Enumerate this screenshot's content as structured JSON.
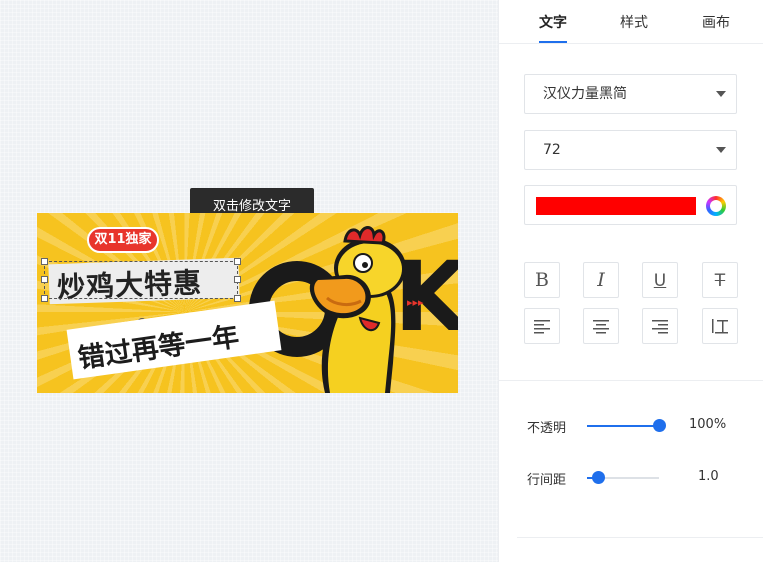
{
  "tooltip": {
    "text": "双击修改文字"
  },
  "banner": {
    "badge": "双11独家",
    "title": "炒鸡大特惠",
    "subtitle": "错过再等一年",
    "big_letter": "K",
    "arrows": "▸▸▸",
    "colors": {
      "background": "#f6c31f",
      "badge": "#e8352c",
      "dark": "#1a1a1a"
    }
  },
  "panel": {
    "tabs": [
      {
        "label": "文字",
        "active": true
      },
      {
        "label": "样式",
        "active": false
      },
      {
        "label": "画布",
        "active": false
      }
    ],
    "font_select": {
      "value": "汉仪力量黑简"
    },
    "size_select": {
      "value": "72"
    },
    "text_color": "#ff0000",
    "format_buttons": [
      "bold",
      "italic",
      "underline",
      "strikethrough",
      "align-left",
      "align-center",
      "align-right",
      "line-height"
    ],
    "format_glyphs": {
      "bold": "B",
      "italic": "I",
      "underline": "U",
      "strikethrough": "T"
    },
    "opacity": {
      "label": "不透明",
      "value": "100%",
      "fraction": 1.0
    },
    "line_spacing": {
      "label": "行间距",
      "value": "1.0",
      "fraction": 0.15
    },
    "accent": "#1f6fec"
  }
}
